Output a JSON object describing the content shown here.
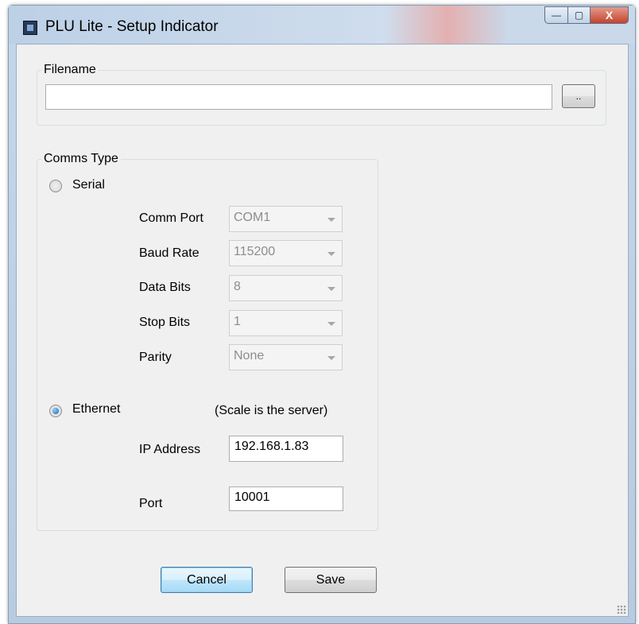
{
  "window": {
    "title": "PLU Lite - Setup Indicator",
    "controls": {
      "minimize": "—",
      "maximize": "▢",
      "close": "X"
    }
  },
  "filename": {
    "group_label": "Filename",
    "value": "",
    "browse_label": ".."
  },
  "comms": {
    "group_label": "Comms Type",
    "serial": {
      "label": "Serial",
      "checked": false,
      "fields": [
        {
          "label": "Comm Port",
          "value": "COM1"
        },
        {
          "label": "Baud Rate",
          "value": "115200"
        },
        {
          "label": "Data Bits",
          "value": "8"
        },
        {
          "label": "Stop Bits",
          "value": "1"
        },
        {
          "label": "Parity",
          "value": "None"
        }
      ]
    },
    "ethernet": {
      "label": "Ethernet",
      "checked": true,
      "note": "(Scale is  the server)",
      "ip_label": "IP Address",
      "ip_value": "192.168.1.83",
      "port_label": "Port",
      "port_value": "10001"
    }
  },
  "buttons": {
    "cancel": "Cancel",
    "save": "Save"
  },
  "colors": {
    "title_bar": "#c5d6e8",
    "client_bg": "#f0f0f0",
    "close_button": "#c5432c",
    "default_button_border": "#3c7fb1"
  }
}
